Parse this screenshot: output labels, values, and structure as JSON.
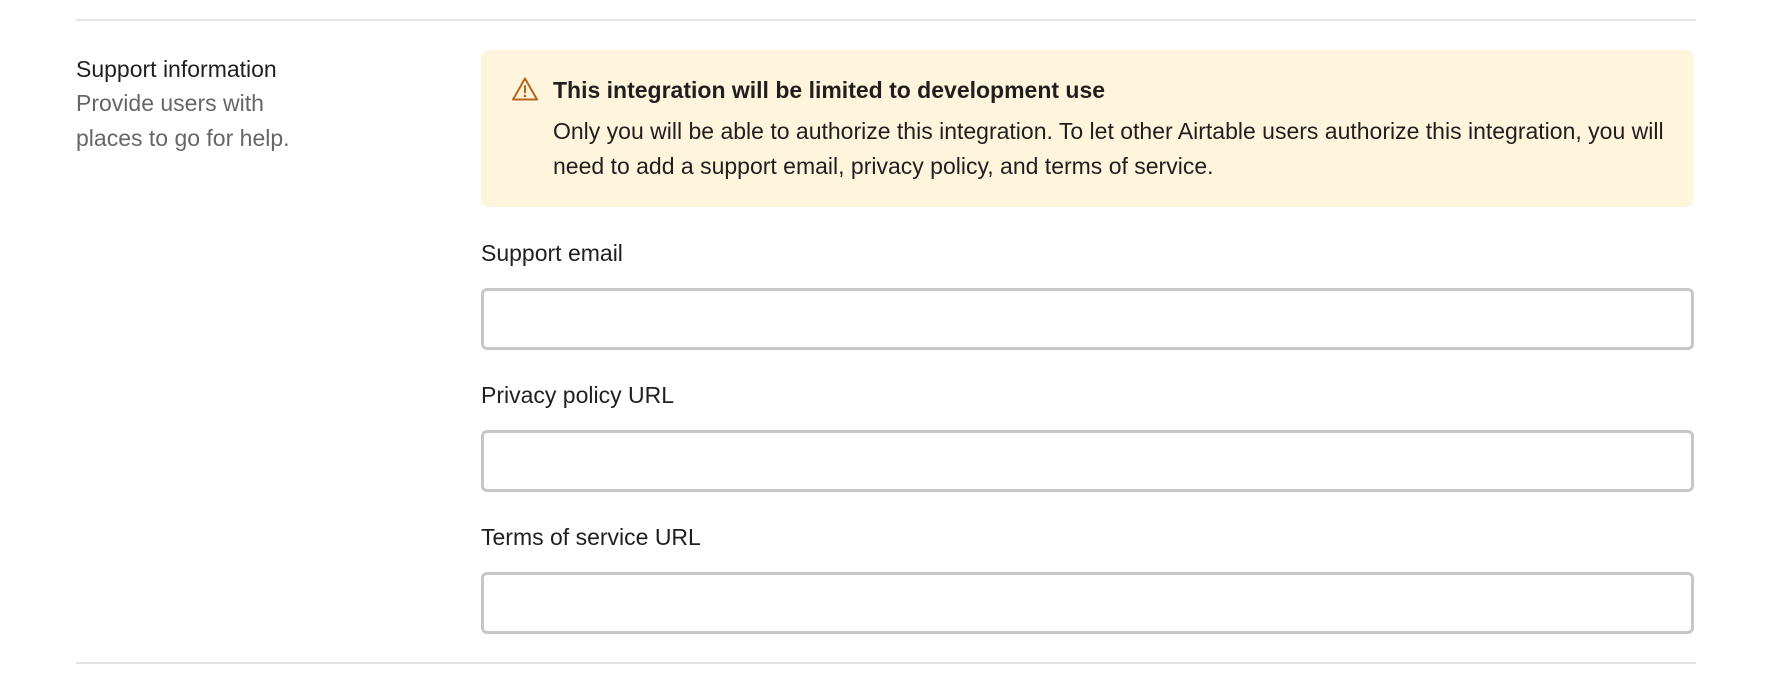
{
  "section": {
    "title": "Support information",
    "description": "Provide users with places to go for help."
  },
  "alert": {
    "icon": "warning-icon",
    "title": "This integration will be limited to development use",
    "body": "Only you will be able to authorize this integration. To let other Airtable users authorize this integration, you will need to add a support email, privacy policy, and terms of service.",
    "background_color": "#fff5dc",
    "icon_color": "#b8651b"
  },
  "fields": {
    "support_email": {
      "label": "Support email",
      "value": ""
    },
    "privacy_policy_url": {
      "label": "Privacy policy URL",
      "value": ""
    },
    "terms_of_service_url": {
      "label": "Terms of service URL",
      "value": ""
    }
  }
}
